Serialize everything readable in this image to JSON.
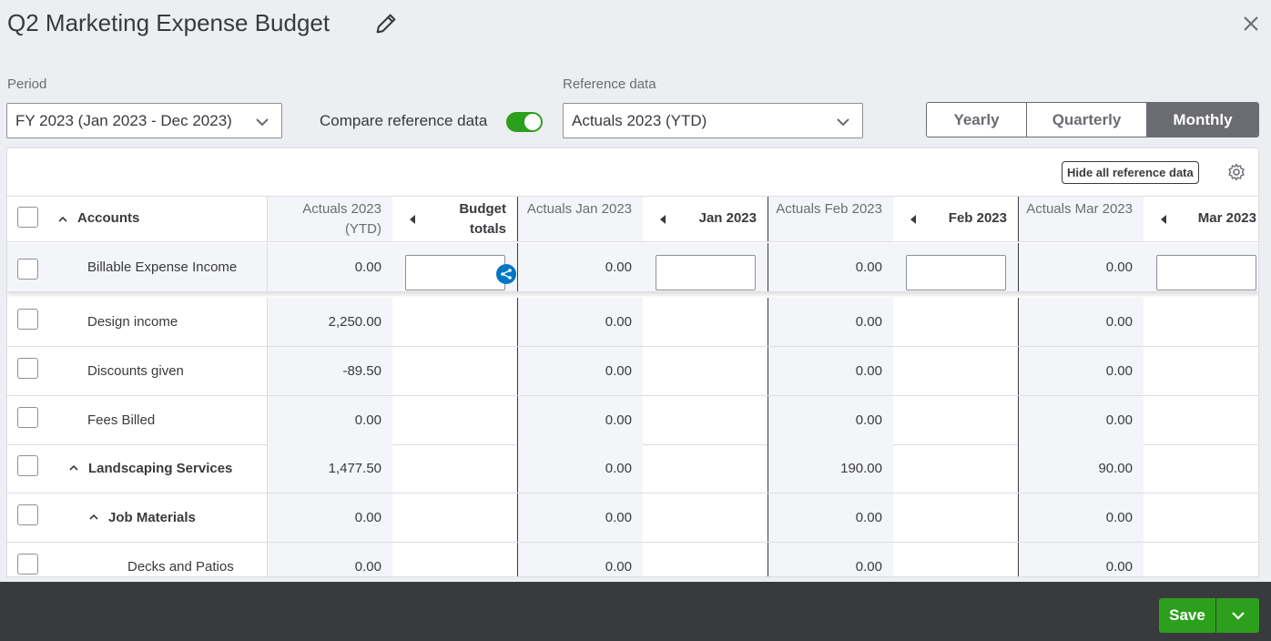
{
  "title": "Q2 Marketing Expense Budget",
  "period": {
    "label": "Period",
    "value": "FY 2023 (Jan 2023 - Dec 2023)"
  },
  "compare": {
    "label": "Compare reference data",
    "enabled": true
  },
  "reference": {
    "label": "Reference data",
    "value": "Actuals 2023 (YTD)"
  },
  "view_modes": [
    "Yearly",
    "Quarterly",
    "Monthly"
  ],
  "active_view": "Monthly",
  "hide_ref_label": "Hide all reference data",
  "columns": {
    "accounts": "Accounts",
    "ref_total": "Actuals 2023 (YTD)",
    "budget_total": "Budget totals",
    "ref_jan": "Actuals Jan 2023",
    "jan": "Jan 2023",
    "ref_feb": "Actuals Feb 2023",
    "feb": "Feb 2023",
    "ref_mar": "Actuals Mar 2023",
    "mar": "Mar 2023"
  },
  "rows": [
    {
      "name": "Billable Expense Income",
      "ytd": "0.00",
      "jan": "0.00",
      "feb": "0.00",
      "mar": "0.00"
    },
    {
      "name": "Design income",
      "ytd": "2,250.00",
      "jan": "0.00",
      "feb": "0.00",
      "mar": "0.00"
    },
    {
      "name": "Discounts given",
      "ytd": "-89.50",
      "jan": "0.00",
      "feb": "0.00",
      "mar": "0.00"
    },
    {
      "name": "Fees Billed",
      "ytd": "0.00",
      "jan": "0.00",
      "feb": "0.00",
      "mar": "0.00"
    },
    {
      "name": "Landscaping Services",
      "ytd": "1,477.50",
      "jan": "0.00",
      "feb": "190.00",
      "mar": "90.00"
    },
    {
      "name": "Job Materials",
      "ytd": "0.00",
      "jan": "0.00",
      "feb": "0.00",
      "mar": "0.00"
    },
    {
      "name": "Decks and Patios",
      "ytd": "0.00",
      "jan": "0.00",
      "feb": "0.00",
      "mar": "0.00"
    }
  ],
  "save_label": "Save",
  "colors": {
    "accent": "#2ca01c",
    "footer": "#393a3d",
    "active_tab": "#6b6c72"
  }
}
